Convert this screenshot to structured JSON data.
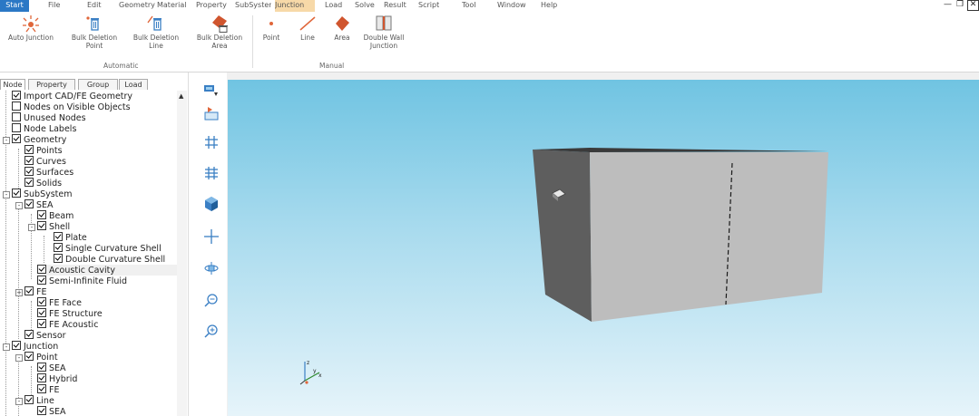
{
  "menu": {
    "items": [
      "Start",
      "File",
      "Edit",
      "Geometry",
      "Material",
      "Property",
      "SubSystem",
      "Junction",
      "Load",
      "Solve",
      "Result",
      "Script",
      "Tool",
      "Window",
      "Help"
    ],
    "window_controls": [
      "—",
      "❐",
      "✕"
    ]
  },
  "ribbon": {
    "buttons": [
      "Auto Junction",
      "Bulk Deletion Point",
      "Bulk Deletion Line",
      "Bulk Deletion Area",
      "Point",
      "Line",
      "Area",
      "Double Wall Junction"
    ],
    "groups": [
      "Automatic",
      "Manual"
    ]
  },
  "panel": {
    "tabs": [
      "Node",
      "Property",
      "Group",
      "Load"
    ],
    "tree": [
      {
        "label": "Import CAD/FE Geometry",
        "checked": true
      },
      {
        "label": "Nodes on Visible Objects",
        "checked": false
      },
      {
        "label": "Unused Nodes",
        "checked": false
      },
      {
        "label": "Node Labels",
        "checked": false
      },
      {
        "label": "Geometry",
        "checked": true
      },
      {
        "label": "Points",
        "checked": true
      },
      {
        "label": "Curves",
        "checked": true
      },
      {
        "label": "Surfaces",
        "checked": true
      },
      {
        "label": "Solids",
        "checked": true
      },
      {
        "label": "SubSystem",
        "checked": true
      },
      {
        "label": "SEA",
        "checked": true
      },
      {
        "label": "Beam",
        "checked": true
      },
      {
        "label": "Shell",
        "checked": true
      },
      {
        "label": "Plate",
        "checked": true
      },
      {
        "label": "Single Curvature Shell",
        "checked": true
      },
      {
        "label": "Double Curvature Shell",
        "checked": true
      },
      {
        "label": "Acoustic Cavity",
        "checked": true
      },
      {
        "label": "Semi-Infinite Fluid",
        "checked": true
      },
      {
        "label": "FE",
        "checked": true
      },
      {
        "label": "FE Face",
        "checked": true
      },
      {
        "label": "FE Structure",
        "checked": true
      },
      {
        "label": "FE Acoustic",
        "checked": true
      },
      {
        "label": "Sensor",
        "checked": true
      },
      {
        "label": "Junction",
        "checked": true
      },
      {
        "label": "Point",
        "checked": true
      },
      {
        "label": "SEA",
        "checked": true
      },
      {
        "label": "Hybrid",
        "checked": true
      },
      {
        "label": "FE",
        "checked": true
      },
      {
        "label": "Line",
        "checked": true
      },
      {
        "label": "SEA",
        "checked": true
      }
    ]
  },
  "toolbar": {
    "icons": [
      "select-mode-icon",
      "view-fit-icon",
      "grid-icon",
      "grid-snap-icon",
      "cube-view-icon",
      "pan-icon",
      "rotate-icon",
      "zoom-out-icon",
      "zoom-in-icon"
    ]
  },
  "viewport": {
    "axis_labels": [
      "z",
      "y",
      "x"
    ]
  }
}
